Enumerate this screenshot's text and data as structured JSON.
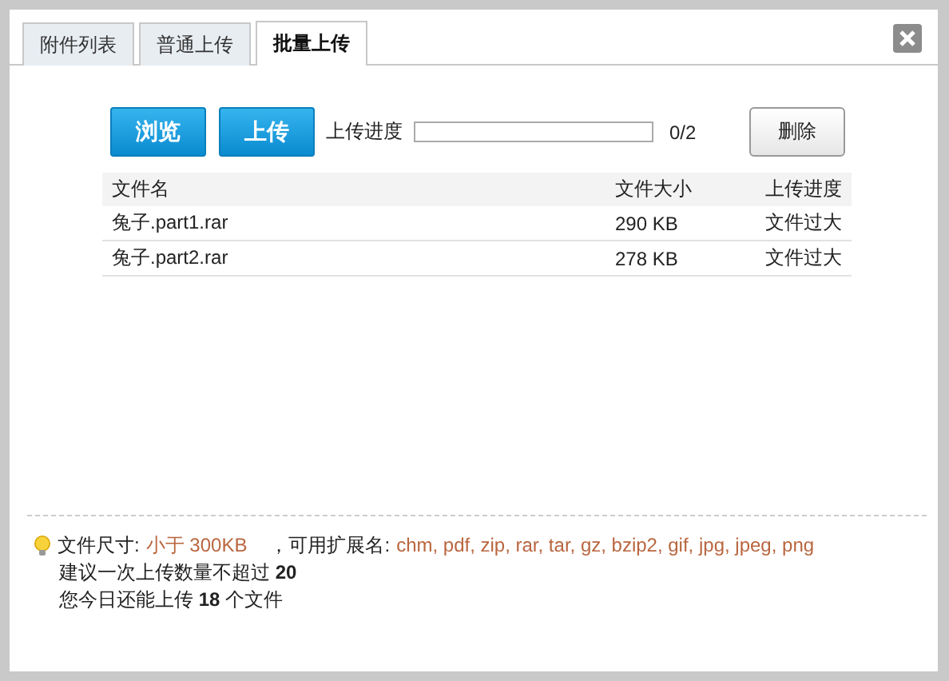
{
  "tabs": [
    {
      "label": "附件列表",
      "selected": false
    },
    {
      "label": "普通上传",
      "selected": false
    },
    {
      "label": "批量上传",
      "selected": true
    }
  ],
  "toolbar": {
    "browse_button": "浏览",
    "upload_button": "上传",
    "progress_label": "上传进度",
    "progress": {
      "level": 0
    },
    "progress_count": "0/2",
    "delete_button": "删除"
  },
  "table": {
    "columns": [
      "文件名",
      "文件大小",
      "上传进度"
    ],
    "rows": [
      [
        "兔子.part1.rar",
        "290 KB",
        "文件过大"
      ],
      [
        "兔子.part2.rar",
        "278 KB",
        "文件过大"
      ]
    ]
  },
  "notes": {
    "size_label": "文件尺寸:",
    "size_limit": "小于 300KB",
    "ext_label": "，可用扩展名:",
    "extensions": "chm, pdf, zip, rar, tar, gz, bzip2, gif, jpg, jpeg, png",
    "lines": [
      "建议一次上传数量不超过 **20**",
      "您今日还能上传 **18** 个文件"
    ]
  }
}
